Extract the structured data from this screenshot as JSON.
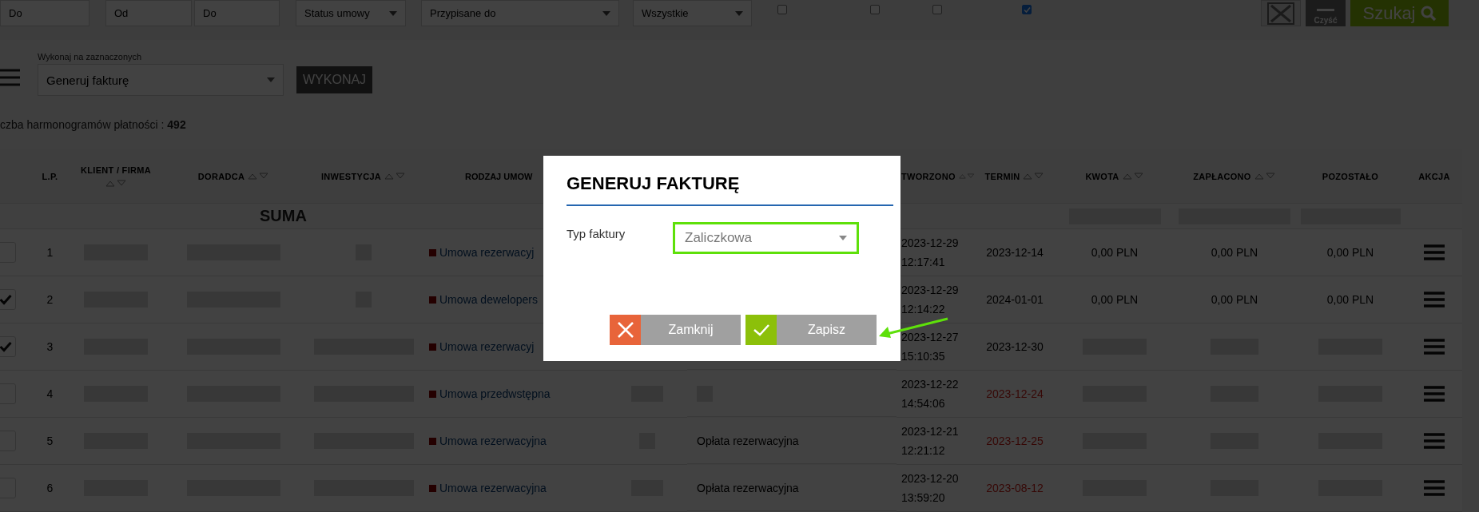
{
  "filters": {
    "fields": [
      {
        "kind": "input",
        "placeholder": "Do"
      },
      {
        "kind": "input",
        "placeholder": "Od"
      },
      {
        "kind": "input",
        "placeholder": "Do"
      },
      {
        "kind": "select",
        "value": "Status umowy"
      },
      {
        "kind": "select",
        "value": "Przypisane do"
      },
      {
        "kind": "select",
        "value": "Wszystkie"
      }
    ],
    "checkboxes": [
      {
        "checked": false
      },
      {
        "checked": false
      },
      {
        "checked": false
      },
      {
        "checked": true
      }
    ],
    "clear_label": "Czyść",
    "search_label": "Szukaj"
  },
  "bulk_action": {
    "label": "Wykonaj na zaznaczonych",
    "value": "Generuj fakturę",
    "button": "WYKONAJ"
  },
  "count": {
    "label": "czba harmonogramów płatności : ",
    "value": "492"
  },
  "table": {
    "columns": [
      {
        "label": "L.P.",
        "sortable": false
      },
      {
        "label": "KLIENT / FIRMA",
        "sortable": true
      },
      {
        "label": "DORADCA",
        "sortable": true
      },
      {
        "label": "INWESTYCJA",
        "sortable": true
      },
      {
        "label": "RODZAJ UMOW",
        "sortable": false
      },
      {
        "label": "TWORZONO",
        "sortable": true
      },
      {
        "label": "TERMIN",
        "sortable": true
      },
      {
        "label": "KWOTA",
        "sortable": true
      },
      {
        "label": "ZAPŁACONO",
        "sortable": true
      },
      {
        "label": "POZOSTAŁO",
        "sortable": false
      },
      {
        "label": "AKCJA",
        "sortable": false
      }
    ],
    "sum_label": "SUMA",
    "rows": [
      {
        "checked": false,
        "lp": "1",
        "contract_type": "Umowa rezerwacyj",
        "created": "2023-12-29 12:17:41",
        "due": "2023-12-14",
        "overdue": false,
        "amount": "0,00 PLN",
        "paid": "0,00 PLN",
        "remaining": "0,00 PLN"
      },
      {
        "checked": true,
        "lp": "2",
        "contract_type": "Umowa dewelopers",
        "created": "2023-12-29 12:14:22",
        "due": "2024-01-01",
        "overdue": false,
        "amount": "0,00 PLN",
        "paid": "0,00 PLN",
        "remaining": "0,00 PLN"
      },
      {
        "checked": true,
        "lp": "3",
        "contract_type": "Umowa rezerwacyj",
        "created": "2023-12-27 15:10:35",
        "due": "2023-12-30",
        "overdue": false
      },
      {
        "checked": false,
        "lp": "4",
        "contract_type": "Umowa przedwstępna",
        "created": "2023-12-22 14:54:06",
        "due": "2023-12-24",
        "overdue": true
      },
      {
        "checked": false,
        "lp": "5",
        "contract_type": "Umowa rezerwacyjna",
        "column_8": "Opłata rezerwacyjna",
        "created": "2023-12-21 12:21:12",
        "due": "2023-12-25",
        "overdue": true
      },
      {
        "checked": false,
        "lp": "6",
        "contract_type": "Umowa rezerwacyjna",
        "column_8": "Opłata rezerwacyjna",
        "created": "2023-12-20 13:59:20",
        "due": "2023-08-12",
        "overdue": true
      }
    ]
  },
  "dialog": {
    "title": "GENERUJ FAKTURĘ",
    "field_label": "Typ faktury",
    "field_value": "Zaliczkowa",
    "buttons": [
      {
        "kind": "close",
        "label": "Zamknij"
      },
      {
        "kind": "save",
        "label": "Zapisz"
      }
    ]
  }
}
